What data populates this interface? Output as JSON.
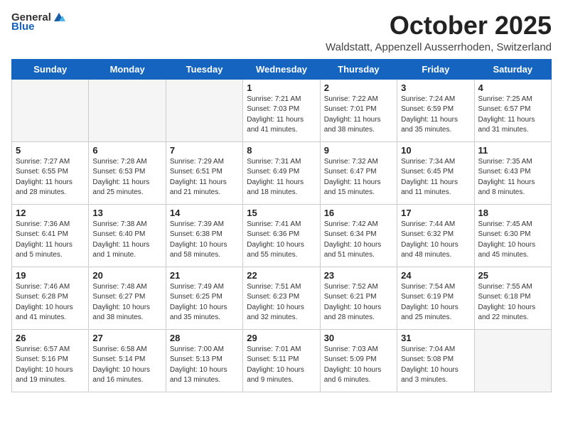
{
  "header": {
    "logo_general": "General",
    "logo_blue": "Blue",
    "month_title": "October 2025",
    "subtitle": "Waldstatt, Appenzell Ausserrhoden, Switzerland"
  },
  "days_of_week": [
    "Sunday",
    "Monday",
    "Tuesday",
    "Wednesday",
    "Thursday",
    "Friday",
    "Saturday"
  ],
  "weeks": [
    [
      {
        "day": "",
        "info": ""
      },
      {
        "day": "",
        "info": ""
      },
      {
        "day": "",
        "info": ""
      },
      {
        "day": "1",
        "info": "Sunrise: 7:21 AM\nSunset: 7:03 PM\nDaylight: 11 hours\nand 41 minutes."
      },
      {
        "day": "2",
        "info": "Sunrise: 7:22 AM\nSunset: 7:01 PM\nDaylight: 11 hours\nand 38 minutes."
      },
      {
        "day": "3",
        "info": "Sunrise: 7:24 AM\nSunset: 6:59 PM\nDaylight: 11 hours\nand 35 minutes."
      },
      {
        "day": "4",
        "info": "Sunrise: 7:25 AM\nSunset: 6:57 PM\nDaylight: 11 hours\nand 31 minutes."
      }
    ],
    [
      {
        "day": "5",
        "info": "Sunrise: 7:27 AM\nSunset: 6:55 PM\nDaylight: 11 hours\nand 28 minutes."
      },
      {
        "day": "6",
        "info": "Sunrise: 7:28 AM\nSunset: 6:53 PM\nDaylight: 11 hours\nand 25 minutes."
      },
      {
        "day": "7",
        "info": "Sunrise: 7:29 AM\nSunset: 6:51 PM\nDaylight: 11 hours\nand 21 minutes."
      },
      {
        "day": "8",
        "info": "Sunrise: 7:31 AM\nSunset: 6:49 PM\nDaylight: 11 hours\nand 18 minutes."
      },
      {
        "day": "9",
        "info": "Sunrise: 7:32 AM\nSunset: 6:47 PM\nDaylight: 11 hours\nand 15 minutes."
      },
      {
        "day": "10",
        "info": "Sunrise: 7:34 AM\nSunset: 6:45 PM\nDaylight: 11 hours\nand 11 minutes."
      },
      {
        "day": "11",
        "info": "Sunrise: 7:35 AM\nSunset: 6:43 PM\nDaylight: 11 hours\nand 8 minutes."
      }
    ],
    [
      {
        "day": "12",
        "info": "Sunrise: 7:36 AM\nSunset: 6:41 PM\nDaylight: 11 hours\nand 5 minutes."
      },
      {
        "day": "13",
        "info": "Sunrise: 7:38 AM\nSunset: 6:40 PM\nDaylight: 11 hours\nand 1 minute."
      },
      {
        "day": "14",
        "info": "Sunrise: 7:39 AM\nSunset: 6:38 PM\nDaylight: 10 hours\nand 58 minutes."
      },
      {
        "day": "15",
        "info": "Sunrise: 7:41 AM\nSunset: 6:36 PM\nDaylight: 10 hours\nand 55 minutes."
      },
      {
        "day": "16",
        "info": "Sunrise: 7:42 AM\nSunset: 6:34 PM\nDaylight: 10 hours\nand 51 minutes."
      },
      {
        "day": "17",
        "info": "Sunrise: 7:44 AM\nSunset: 6:32 PM\nDaylight: 10 hours\nand 48 minutes."
      },
      {
        "day": "18",
        "info": "Sunrise: 7:45 AM\nSunset: 6:30 PM\nDaylight: 10 hours\nand 45 minutes."
      }
    ],
    [
      {
        "day": "19",
        "info": "Sunrise: 7:46 AM\nSunset: 6:28 PM\nDaylight: 10 hours\nand 41 minutes."
      },
      {
        "day": "20",
        "info": "Sunrise: 7:48 AM\nSunset: 6:27 PM\nDaylight: 10 hours\nand 38 minutes."
      },
      {
        "day": "21",
        "info": "Sunrise: 7:49 AM\nSunset: 6:25 PM\nDaylight: 10 hours\nand 35 minutes."
      },
      {
        "day": "22",
        "info": "Sunrise: 7:51 AM\nSunset: 6:23 PM\nDaylight: 10 hours\nand 32 minutes."
      },
      {
        "day": "23",
        "info": "Sunrise: 7:52 AM\nSunset: 6:21 PM\nDaylight: 10 hours\nand 28 minutes."
      },
      {
        "day": "24",
        "info": "Sunrise: 7:54 AM\nSunset: 6:19 PM\nDaylight: 10 hours\nand 25 minutes."
      },
      {
        "day": "25",
        "info": "Sunrise: 7:55 AM\nSunset: 6:18 PM\nDaylight: 10 hours\nand 22 minutes."
      }
    ],
    [
      {
        "day": "26",
        "info": "Sunrise: 6:57 AM\nSunset: 5:16 PM\nDaylight: 10 hours\nand 19 minutes."
      },
      {
        "day": "27",
        "info": "Sunrise: 6:58 AM\nSunset: 5:14 PM\nDaylight: 10 hours\nand 16 minutes."
      },
      {
        "day": "28",
        "info": "Sunrise: 7:00 AM\nSunset: 5:13 PM\nDaylight: 10 hours\nand 13 minutes."
      },
      {
        "day": "29",
        "info": "Sunrise: 7:01 AM\nSunset: 5:11 PM\nDaylight: 10 hours\nand 9 minutes."
      },
      {
        "day": "30",
        "info": "Sunrise: 7:03 AM\nSunset: 5:09 PM\nDaylight: 10 hours\nand 6 minutes."
      },
      {
        "day": "31",
        "info": "Sunrise: 7:04 AM\nSunset: 5:08 PM\nDaylight: 10 hours\nand 3 minutes."
      },
      {
        "day": "",
        "info": ""
      }
    ]
  ]
}
